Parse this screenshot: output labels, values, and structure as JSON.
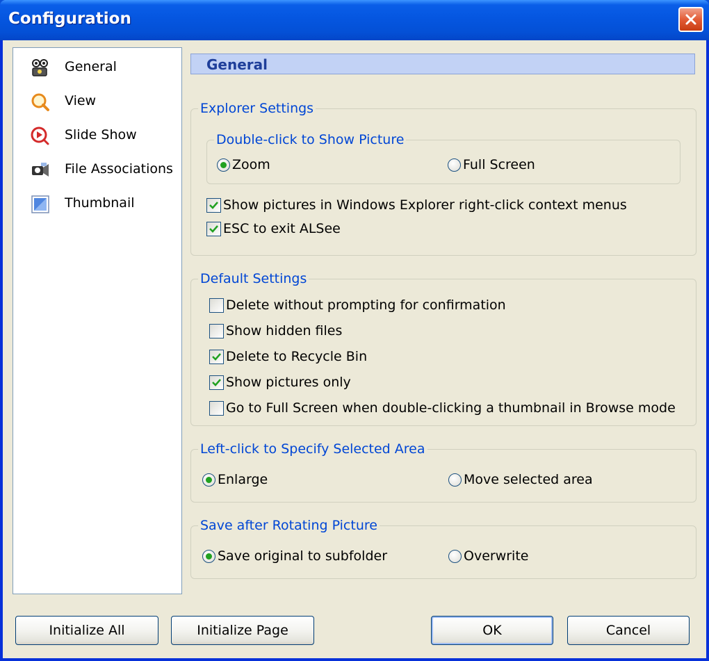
{
  "window": {
    "title": "Configuration"
  },
  "nav": {
    "items": [
      {
        "label": "General",
        "icon": "camera-people-icon"
      },
      {
        "label": "View",
        "icon": "magnifier-icon"
      },
      {
        "label": "Slide Show",
        "icon": "slideshow-play-icon"
      },
      {
        "label": "File Associations",
        "icon": "file-associations-icon"
      },
      {
        "label": "Thumbnail",
        "icon": "thumbnail-icon"
      }
    ]
  },
  "page": {
    "header": "General"
  },
  "explorer_settings": {
    "legend": "Explorer Settings",
    "double_click": {
      "legend": "Double-click to Show Picture",
      "zoom": "Zoom",
      "full_screen": "Full Screen",
      "selected": "Zoom"
    },
    "context_menu": {
      "label": "Show pictures in Windows Explorer right-click context menus",
      "checked": true
    },
    "esc_exit": {
      "label": "ESC to exit ALSee",
      "checked": true
    }
  },
  "default_settings": {
    "legend": "Default Settings",
    "options": [
      {
        "label": "Delete without prompting for confirmation",
        "checked": false
      },
      {
        "label": "Show hidden files",
        "checked": false
      },
      {
        "label": "Delete to Recycle Bin",
        "checked": true
      },
      {
        "label": "Show pictures only",
        "checked": true
      },
      {
        "label": "Go to Full Screen when double-clicking a thumbnail in Browse mode",
        "checked": false
      }
    ]
  },
  "left_click": {
    "legend": "Left-click to Specify Selected Area",
    "enlarge": "Enlarge",
    "move": "Move selected area",
    "selected": "Enlarge"
  },
  "save_rotating": {
    "legend": "Save after Rotating Picture",
    "save_original": "Save original to subfolder",
    "overwrite": "Overwrite",
    "selected": "Save original to subfolder"
  },
  "buttons": {
    "initialize_all": "Initialize All",
    "initialize_page": "Initialize Page",
    "ok": "OK",
    "cancel": "Cancel"
  },
  "colors": {
    "title_bar": "#0556e0",
    "legend_text": "#0046d5",
    "header_band": "#c2d2f5",
    "check_mark": "#21a121"
  }
}
